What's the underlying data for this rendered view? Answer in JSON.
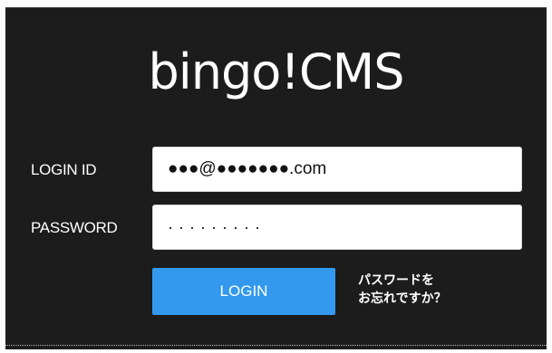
{
  "app": {
    "logo_text": "bingo!CMS"
  },
  "form": {
    "login_id_label": "LOGIN ID",
    "login_id_value": "●●●@●●●●●●●.com",
    "password_label": "PASSWORD",
    "password_value": "·········",
    "login_button_label": "LOGIN",
    "forgot_line1": "パスワードを",
    "forgot_line2": "お忘れですか？"
  },
  "colors": {
    "background": "#1c1c1c",
    "accent": "#3399ee",
    "text": "#ffffff"
  }
}
